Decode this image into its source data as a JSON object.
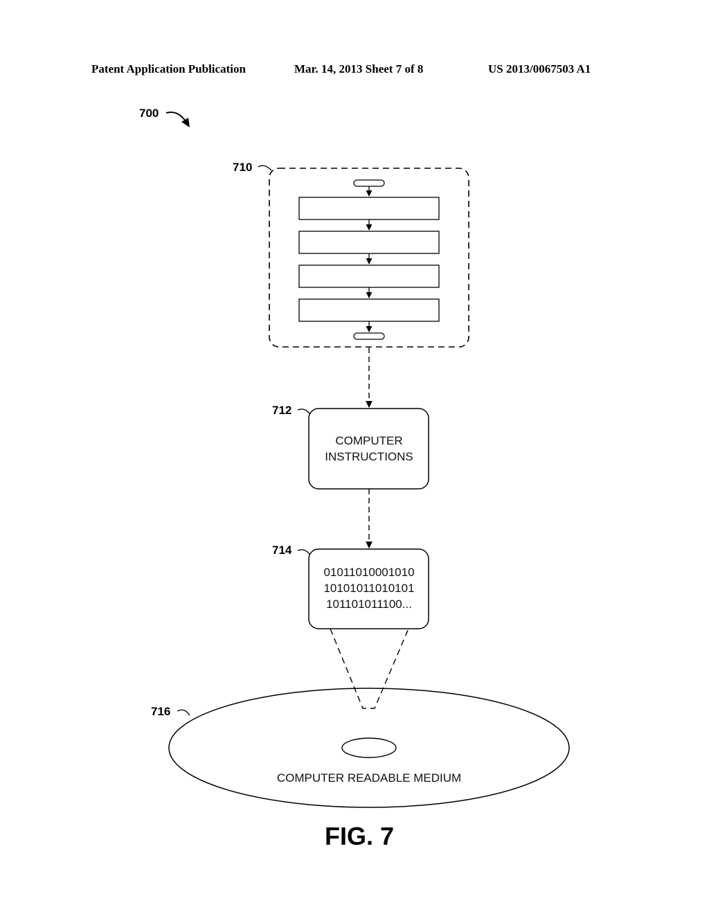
{
  "header": {
    "left": "Patent Application Publication",
    "middle": "Mar. 14, 2013  Sheet 7 of 8",
    "right": "US 2013/0067503 A1"
  },
  "figure": {
    "ref_main": "700",
    "ref_flowchart": "710",
    "ref_instructions": "712",
    "ref_binary": "714",
    "ref_medium": "716",
    "instructions_lines": [
      "COMPUTER",
      "INSTRUCTIONS"
    ],
    "binary_lines": [
      "01011010001010",
      "10101011010101",
      "101101011100..."
    ],
    "medium_label": "COMPUTER READABLE MEDIUM",
    "caption": "FIG. 7"
  }
}
